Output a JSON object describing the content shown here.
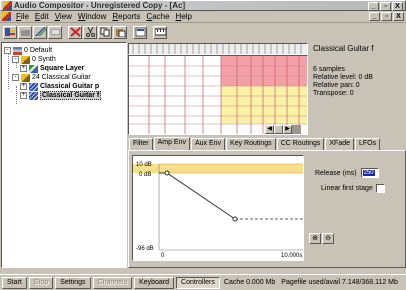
{
  "window": {
    "title": "Audio Compositor - Unregistered Copy - [Ac]",
    "controls": [
      "_",
      "▫",
      "X"
    ],
    "mdi_controls": [
      "_",
      "▫",
      "X"
    ]
  },
  "menu": [
    "File",
    "Edit",
    "View",
    "Window",
    "Reports",
    "Cache",
    "Help"
  ],
  "toolbar": {
    "icons": [
      "new-project-icon",
      "open-folder-icon",
      "add-layer-icon",
      "edit-icon",
      "delete-icon",
      "cut-icon",
      "copy-icon",
      "paste-icon",
      "properties-icon",
      "keyboard-icon"
    ]
  },
  "tree": {
    "nodes": [
      {
        "label": "0 Default",
        "bold": false,
        "expander": "-"
      },
      {
        "label": "0 Synth",
        "bold": false,
        "expander": "-"
      },
      {
        "label": "Square Layer",
        "bold": true,
        "expander": "+"
      },
      {
        "label": "24 Classical Guitar",
        "bold": false,
        "expander": "-"
      },
      {
        "label": "Classical Guitar p",
        "bold": true,
        "expander": "+"
      },
      {
        "label": "Classical Guitar f",
        "bold": true,
        "expander": "+"
      }
    ]
  },
  "info": {
    "title": "Classical Guitar f",
    "lines": [
      "6 samples",
      "Relative level: 0 dB",
      "Relative pan: 0",
      "Transpose: 0"
    ]
  },
  "tabs": [
    "Filter",
    "Amp Env",
    "Aux Env",
    "Key Routings",
    "CC Routings",
    "XFade",
    "LFOs"
  ],
  "active_tab": "Amp Env",
  "envelope": {
    "y_labels": [
      "10 dB",
      "0 dB",
      "-96 dB"
    ],
    "x_labels": [
      "0",
      "10.000s"
    ],
    "release_label": "Release (ms)",
    "release_value": "250",
    "linear_label": "Linear first stage"
  },
  "statusbar": {
    "buttons": [
      {
        "label": "Start",
        "state": "normal"
      },
      {
        "label": "Stop",
        "state": "disabled"
      },
      {
        "label": "Settings",
        "state": "normal"
      },
      {
        "label": "Channels",
        "state": "disabled"
      },
      {
        "label": "Keyboard",
        "state": "normal"
      },
      {
        "label": "Controllers",
        "state": "pressed"
      }
    ],
    "cache": "Cache 0.000 Mb",
    "pagefile": "Pagefile used/avail 7.148/368.112 Mb"
  },
  "colors": {
    "layer_red": "#f4a0a8",
    "layer_yellow": "#fbf2a8",
    "envelope_band": "#f8e08a",
    "selection": "#2028a0"
  }
}
